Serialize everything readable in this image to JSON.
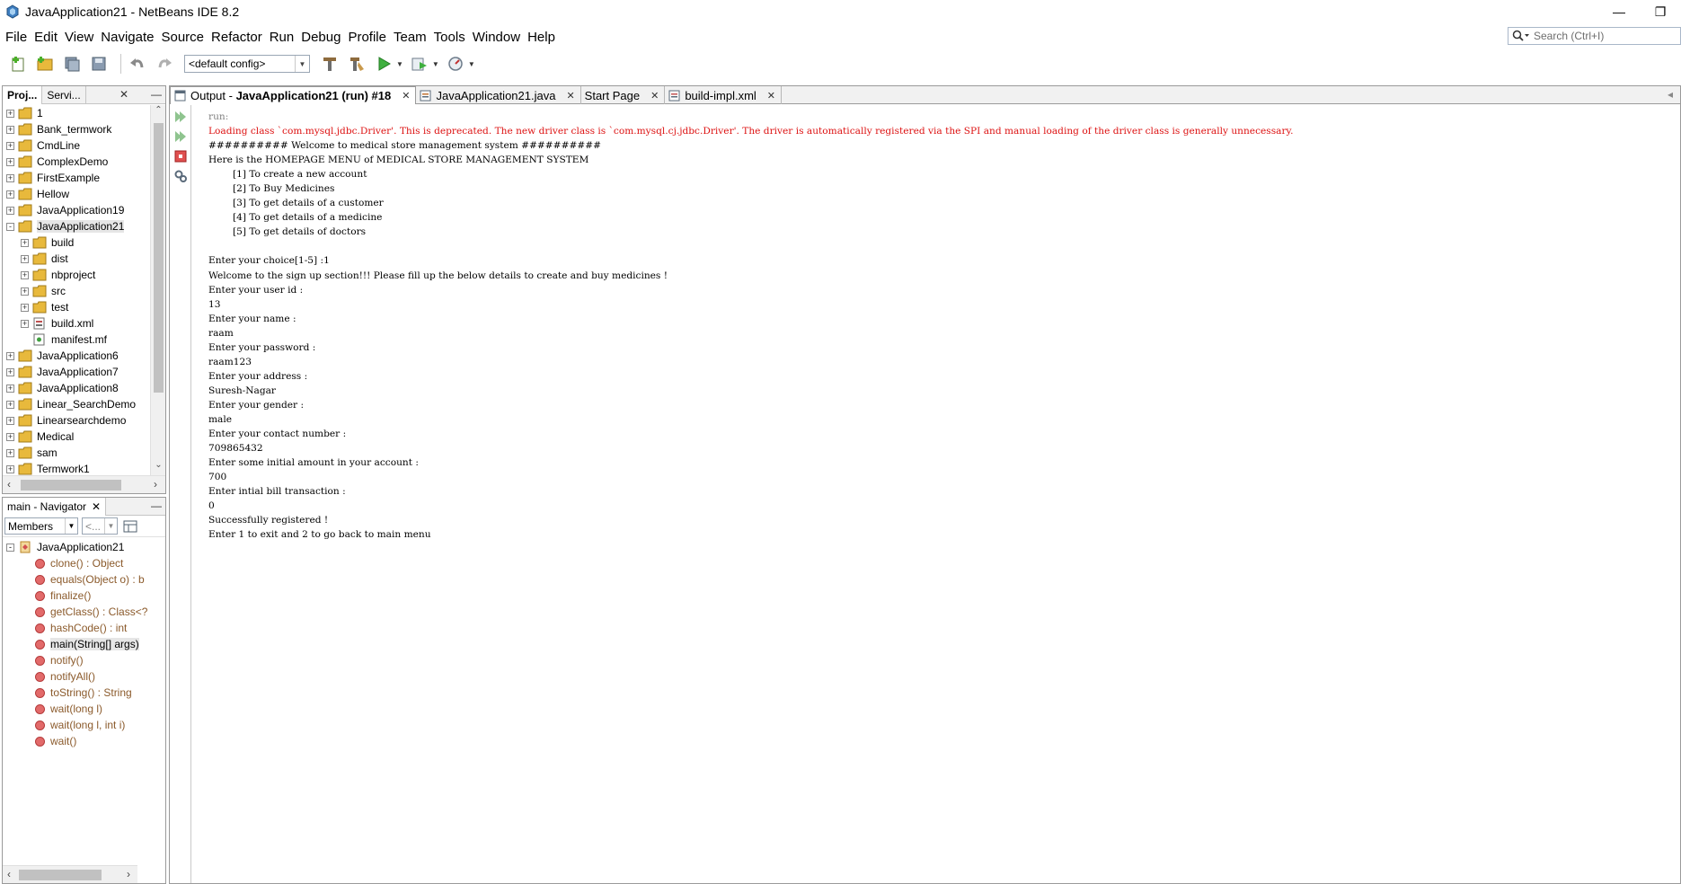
{
  "window": {
    "title": "JavaApplication21 - NetBeans IDE 8.2",
    "minimize_glyph": "—",
    "restore_glyph": "❐"
  },
  "menu": [
    "File",
    "Edit",
    "View",
    "Navigate",
    "Source",
    "Refactor",
    "Run",
    "Debug",
    "Profile",
    "Team",
    "Tools",
    "Window",
    "Help"
  ],
  "search": {
    "placeholder": "Search (Ctrl+I)"
  },
  "toolbar": {
    "config": "<default config>",
    "icons": [
      "new-file-icon",
      "new-project-icon",
      "save-all-icon",
      "save-icon",
      "undo-icon",
      "redo-icon",
      "build-icon",
      "clean-build-icon",
      "run-icon",
      "debug-icon",
      "profile-icon"
    ]
  },
  "projects_panel": {
    "tabs": [
      "Proj...",
      "Servi..."
    ],
    "close_glyph": "✕",
    "minimize_glyph": "—",
    "tree": [
      {
        "label": "1",
        "level": 0,
        "expander": "+",
        "icon": "folder"
      },
      {
        "label": "Bank_termwork",
        "level": 0,
        "expander": "+",
        "icon": "folder"
      },
      {
        "label": "CmdLine",
        "level": 0,
        "expander": "+",
        "icon": "folder"
      },
      {
        "label": "ComplexDemo",
        "level": 0,
        "expander": "+",
        "icon": "folder"
      },
      {
        "label": "FirstExample",
        "level": 0,
        "expander": "+",
        "icon": "folder"
      },
      {
        "label": "Hellow",
        "level": 0,
        "expander": "+",
        "icon": "folder"
      },
      {
        "label": "JavaApplication19",
        "level": 0,
        "expander": "+",
        "icon": "folder"
      },
      {
        "label": "JavaApplication21",
        "level": 0,
        "expander": "-",
        "icon": "folder",
        "selected": true
      },
      {
        "label": "build",
        "level": 1,
        "expander": "+",
        "icon": "folder"
      },
      {
        "label": "dist",
        "level": 1,
        "expander": "+",
        "icon": "folder"
      },
      {
        "label": "nbproject",
        "level": 1,
        "expander": "+",
        "icon": "folder"
      },
      {
        "label": "src",
        "level": 1,
        "expander": "+",
        "icon": "folder"
      },
      {
        "label": "test",
        "level": 1,
        "expander": "+",
        "icon": "folder"
      },
      {
        "label": "build.xml",
        "level": 1,
        "expander": "+",
        "icon": "xml"
      },
      {
        "label": "manifest.mf",
        "level": 1,
        "expander": "",
        "icon": "file"
      },
      {
        "label": "JavaApplication6",
        "level": 0,
        "expander": "+",
        "icon": "folder"
      },
      {
        "label": "JavaApplication7",
        "level": 0,
        "expander": "+",
        "icon": "folder"
      },
      {
        "label": "JavaApplication8",
        "level": 0,
        "expander": "+",
        "icon": "folder"
      },
      {
        "label": "Linear_SearchDemo",
        "level": 0,
        "expander": "+",
        "icon": "folder"
      },
      {
        "label": "Linearsearchdemo",
        "level": 0,
        "expander": "+",
        "icon": "folder"
      },
      {
        "label": "Medical",
        "level": 0,
        "expander": "+",
        "icon": "folder"
      },
      {
        "label": "sam",
        "level": 0,
        "expander": "+",
        "icon": "folder"
      },
      {
        "label": "Termwork1",
        "level": 0,
        "expander": "+",
        "icon": "folder"
      }
    ]
  },
  "navigator": {
    "title": "main - Navigator",
    "close_glyph": "✕",
    "minimize_glyph": "—",
    "filter": "Members",
    "filter2": "<...",
    "class_name": "JavaApplication21",
    "members": [
      {
        "label": "clone() : Object",
        "bold": false
      },
      {
        "label": "equals(Object o) : b",
        "bold": false
      },
      {
        "label": "finalize()",
        "bold": false
      },
      {
        "label": "getClass() : Class<?",
        "bold": false
      },
      {
        "label": "hashCode() : int",
        "bold": false
      },
      {
        "label": "main(String[] args)",
        "bold": true,
        "selected": true
      },
      {
        "label": "notify()",
        "bold": false
      },
      {
        "label": "notifyAll()",
        "bold": false
      },
      {
        "label": "toString() : String",
        "bold": false
      },
      {
        "label": "wait(long l)",
        "bold": false
      },
      {
        "label": "wait(long l, int i)",
        "bold": false
      },
      {
        "label": "wait()",
        "bold": false
      }
    ]
  },
  "editor_tabs": [
    {
      "prefix": "Output - ",
      "label": "JavaApplication21 (run) #18",
      "active": true,
      "icon": "output-icon"
    },
    {
      "prefix": "",
      "label": "JavaApplication21.java",
      "active": false,
      "icon": "java-file-icon"
    },
    {
      "prefix": "",
      "label": "Start Page",
      "active": false,
      "icon": ""
    },
    {
      "prefix": "",
      "label": "build-impl.xml",
      "active": false,
      "icon": "xml-file-icon"
    }
  ],
  "output_lines": [
    {
      "text": "run:",
      "color": "gray"
    },
    {
      "text": "Loading class `com.mysql.jdbc.Driver'. This is deprecated. The new driver class is `com.mysql.cj.jdbc.Driver'. The driver is automatically registered via the SPI and manual loading of the driver class is generally unnecessary.",
      "color": "red"
    },
    {
      "text": "########## Welcome to medical store management system ##########",
      "color": "black"
    },
    {
      "text": "Here is the HOMEPAGE MENU of MEDICAL STORE MANAGEMENT SYSTEM",
      "color": "black"
    },
    {
      "text": "        [1] To create a new account",
      "color": "black"
    },
    {
      "text": "        [2] To Buy Medicines",
      "color": "black"
    },
    {
      "text": "        [3] To get details of a customer",
      "color": "black"
    },
    {
      "text": "        [4] To get details of a medicine",
      "color": "black"
    },
    {
      "text": "        [5] To get details of doctors",
      "color": "black"
    },
    {
      "text": "",
      "color": "black"
    },
    {
      "text": "Enter your choice[1-5] :1",
      "color": "black"
    },
    {
      "text": "Welcome to the sign up section!!! Please fill up the below details to create and buy medicines !",
      "color": "black"
    },
    {
      "text": "Enter your user id :",
      "color": "black"
    },
    {
      "text": "13",
      "color": "black"
    },
    {
      "text": "Enter your name :",
      "color": "black"
    },
    {
      "text": "raam",
      "color": "black"
    },
    {
      "text": "Enter your password :",
      "color": "black"
    },
    {
      "text": "raam123",
      "color": "black"
    },
    {
      "text": "Enter your address :",
      "color": "black"
    },
    {
      "text": "Suresh-Nagar",
      "color": "black"
    },
    {
      "text": "Enter your gender :",
      "color": "black"
    },
    {
      "text": "male",
      "color": "black"
    },
    {
      "text": "Enter your contact number :",
      "color": "black"
    },
    {
      "text": "709865432",
      "color": "black"
    },
    {
      "text": "Enter some initial amount in your account :",
      "color": "black"
    },
    {
      "text": "700",
      "color": "black"
    },
    {
      "text": "Enter intial bill transaction :",
      "color": "black"
    },
    {
      "text": "0",
      "color": "black"
    },
    {
      "text": "Successfully registered !",
      "color": "black"
    },
    {
      "text": "Enter 1 to exit and 2 to go back to main menu",
      "color": "black"
    }
  ],
  "colors": {
    "error_text": "#dd1111",
    "muted_text": "#808080",
    "folder": "#e8b93c",
    "member_dot": "#e26a6a",
    "member_text": "#8b5a2b"
  }
}
